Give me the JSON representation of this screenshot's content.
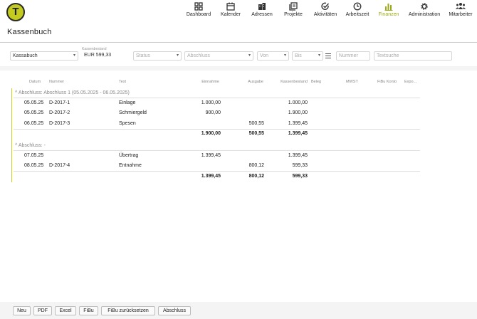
{
  "app": {
    "logo_letter": "T",
    "page_title": "Kassenbuch"
  },
  "nav": [
    {
      "label": "Dashboard",
      "icon": "dashboard-icon"
    },
    {
      "label": "Kalender",
      "icon": "calendar-icon"
    },
    {
      "label": "Adressen",
      "icon": "buildings-icon"
    },
    {
      "label": "Projekte",
      "icon": "projects-icon"
    },
    {
      "label": "Aktivitäten",
      "icon": "activity-check-icon"
    },
    {
      "label": "Arbeitszeit",
      "icon": "clock-icon"
    },
    {
      "label": "Finanzen",
      "icon": "bar-chart-icon",
      "active": true
    },
    {
      "label": "Administration",
      "icon": "gear-icon"
    },
    {
      "label": "Mitarbeiter",
      "icon": "people-icon"
    }
  ],
  "filters": {
    "cashbook": "Kassabuch",
    "balance_label": "Kassenbestand",
    "balance_value": "EUR 599,33",
    "status_placeholder": "Status",
    "closing_placeholder": "Abschluss",
    "from_placeholder": "Von",
    "to_placeholder": "Bis",
    "number_placeholder": "Nummer",
    "search_placeholder": "Textsuche"
  },
  "columns": {
    "datum": "Datum",
    "nummer": "Nummer",
    "text": "Text",
    "einnahme": "Einnahme",
    "ausgabe": "Ausgabe",
    "kassenbestand": "Kassenbestand",
    "beleg": "Beleg",
    "mwst": "MWST",
    "fibu": "FiBu Konto",
    "export": "Expo..."
  },
  "groups": [
    {
      "header": "^ Abschluss: Abschluss 1 (05.05.2025 - 06.05.2025)",
      "rows": [
        {
          "datum": "05.05.25",
          "nummer": "D-2017-1",
          "text": "Einlage",
          "einnahme": "1.000,00",
          "ausgabe": "",
          "bestand": "1.000,00"
        },
        {
          "datum": "05.05.25",
          "nummer": "D-2017-2",
          "text": "Schmiergeld",
          "einnahme": "900,00",
          "ausgabe": "",
          "bestand": "1.900,00"
        },
        {
          "datum": "06.05.25",
          "nummer": "D-2017-3",
          "text": "Spesen",
          "einnahme": "",
          "ausgabe": "500,55",
          "bestand": "1.399,45"
        }
      ],
      "totals": {
        "einnahme": "1.900,00",
        "ausgabe": "500,55",
        "bestand": "1.399,45"
      }
    },
    {
      "header": "^ Abschluss: -",
      "rows": [
        {
          "datum": "07.05.25",
          "nummer": "",
          "text": "Übertrag",
          "einnahme": "1.399,45",
          "ausgabe": "",
          "bestand": "1.399,45"
        },
        {
          "datum": "08.05.25",
          "nummer": "D-2017-4",
          "text": "Entnahme",
          "einnahme": "",
          "ausgabe": "800,12",
          "bestand": "599,33"
        }
      ],
      "totals": {
        "einnahme": "1.399,45",
        "ausgabe": "800,12",
        "bestand": "599,33"
      }
    }
  ],
  "buttons": {
    "neu": "Neu",
    "pdf": "PDF",
    "excel": "Excel",
    "fibu": "FiBu",
    "fibu_reset": "FiBu zurücksetzen",
    "abschluss": "Abschluss"
  },
  "colors": {
    "accent": "#9cab15",
    "logo": "#c3cb1f"
  }
}
